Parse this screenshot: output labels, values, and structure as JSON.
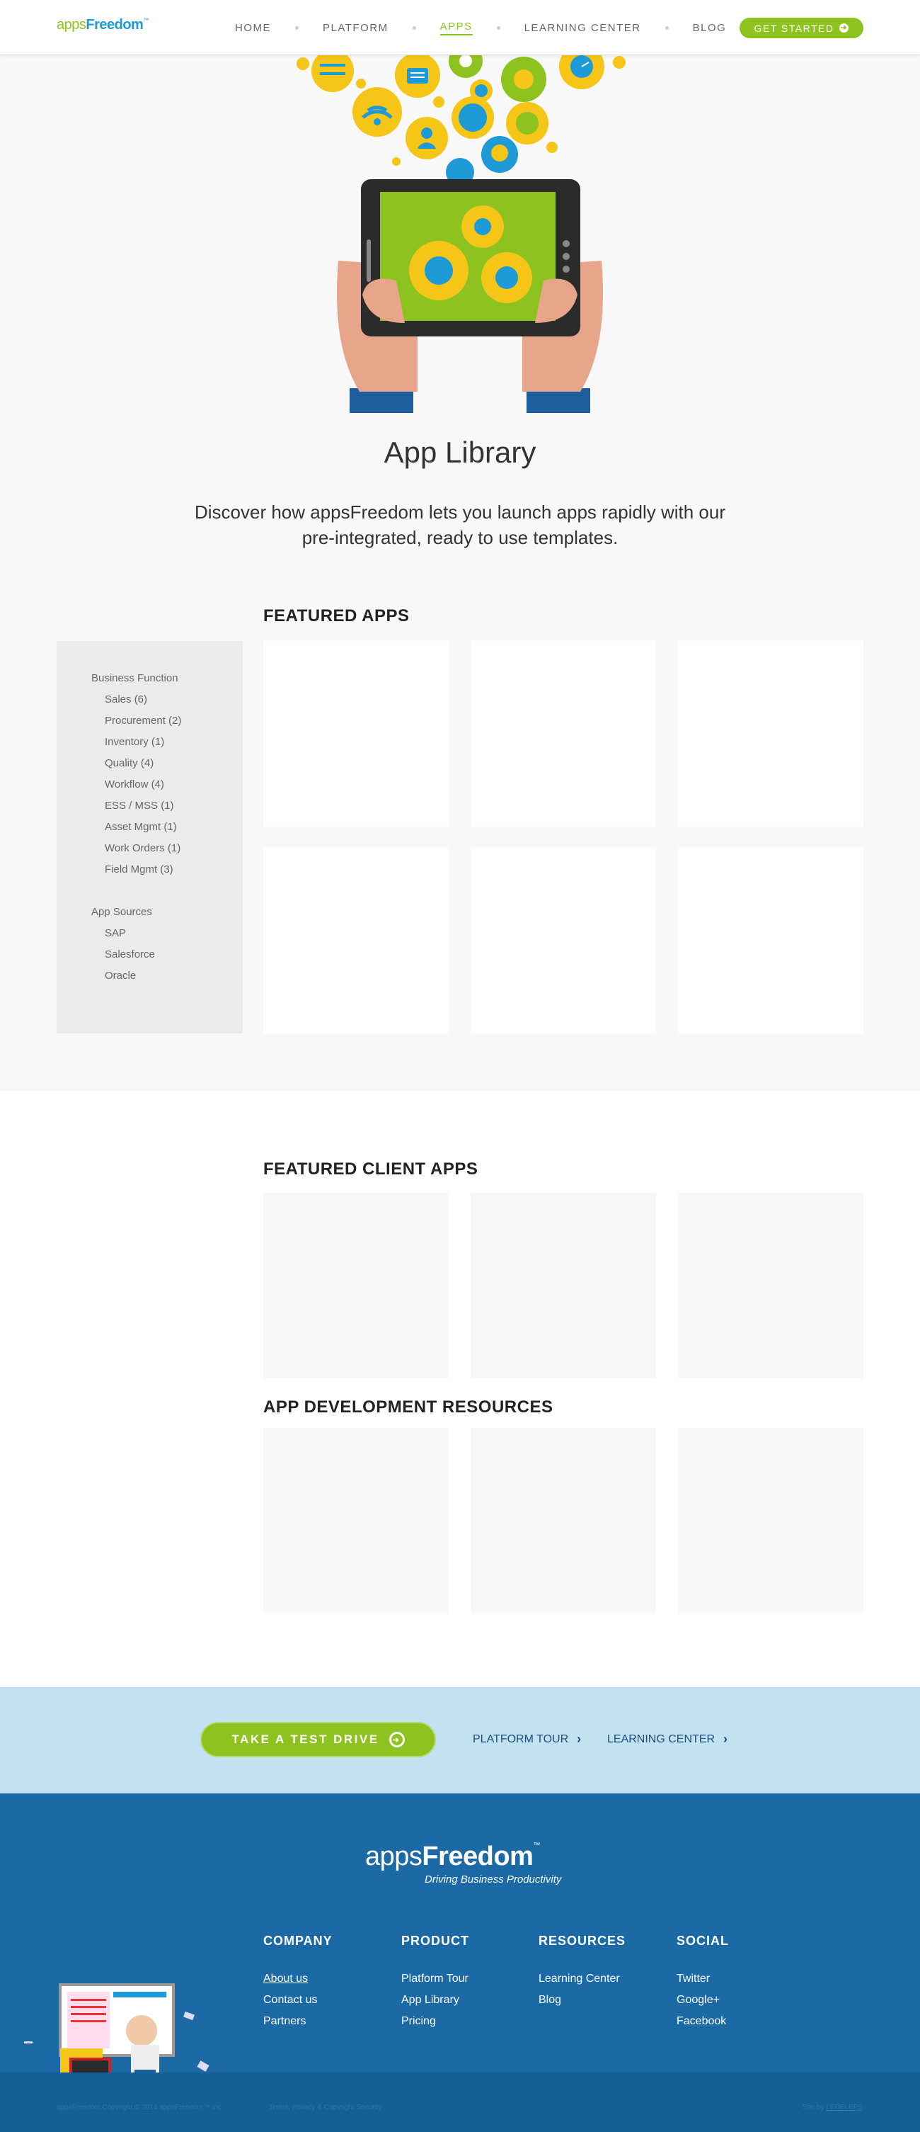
{
  "header": {
    "logo_part1": "apps",
    "logo_part2": "Freedom",
    "logo_tm": "™",
    "nav": [
      "HOME",
      "PLATFORM",
      "APPS",
      "LEARNING CENTER",
      "BLOG"
    ],
    "active_nav": "APPS",
    "cta_label": "GET STARTED"
  },
  "hero": {
    "title": "App Library",
    "subtitle_line1": "Discover how appsFreedom lets you launch apps rapidly with our",
    "subtitle_line2": "pre-integrated, ready to use templates."
  },
  "featured_apps": {
    "heading": "FEATURED APPS",
    "card_count": 6
  },
  "sidebar": {
    "groups": [
      {
        "title": "Business Function",
        "items": [
          "Sales (6)",
          "Procurement (2)",
          "Inventory (1)",
          "Quality (4)",
          "Workflow (4)",
          "ESS / MSS (1)",
          "Asset Mgmt (1)",
          "Work Orders (1)",
          "Field Mgmt (3)"
        ]
      },
      {
        "title": "App Sources",
        "items": [
          "SAP",
          "Salesforce",
          "Oracle"
        ]
      }
    ]
  },
  "featured_client_apps": {
    "heading": "FEATURED CLIENT APPS",
    "card_count": 3
  },
  "resources": {
    "heading": "APP DEVELOPMENT RESOURCES",
    "card_count": 3
  },
  "test_drive": {
    "button_label": "TAKE A TEST DRIVE",
    "link1": "PLATFORM TOUR",
    "link2": "LEARNING CENTER"
  },
  "footer": {
    "logo_part1": "apps",
    "logo_part2": "Freedom",
    "logo_tm": "™",
    "tagline": "Driving Business Productivity",
    "columns": [
      {
        "heading": "COMPANY",
        "links": [
          "About us",
          "Contact us",
          "Partners"
        ]
      },
      {
        "heading": "PRODUCT",
        "links": [
          "Platform Tour",
          "App Library",
          "Pricing"
        ]
      },
      {
        "heading": "RESOURCES",
        "links": [
          "Learning Center",
          "Blog"
        ]
      },
      {
        "heading": "SOCIAL",
        "links": [
          "Twitter",
          "Google+",
          "Facebook"
        ]
      }
    ],
    "copyright": "appsFreedom Copyright © 2014 appsFreedom™ Inc",
    "terms": "Terms, Privacy & Copyright Security",
    "site_by_label": "Site by",
    "site_by_link": "LEDELEPS"
  },
  "colors": {
    "brand_green": "#8dc21f",
    "brand_blue": "#1e9ad6",
    "footer_blue": "#1b6aa5",
    "band_light_blue": "#c3e2f1"
  }
}
